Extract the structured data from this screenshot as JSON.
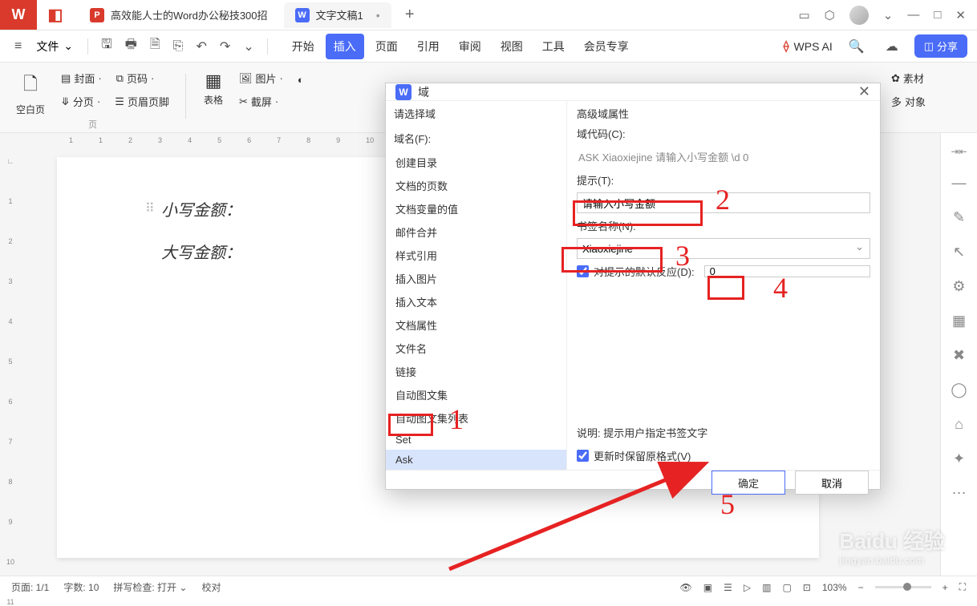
{
  "titlebar": {
    "tab1": "高效能人士的Word办公秘技300招",
    "tab2": "文字文稿1",
    "add": "+"
  },
  "menubar": {
    "file": "文件",
    "tabs": [
      "开始",
      "插入",
      "页面",
      "引用",
      "审阅",
      "视图",
      "工具",
      "会员专享"
    ],
    "active_tab_index": 1,
    "ai": "WPS AI",
    "share": "分享"
  },
  "ribbon": {
    "blank_page": "空白页",
    "cover": "封面",
    "page_break": "分页",
    "page_number": "页码",
    "header_footer": "页眉页脚",
    "group1_label": "页",
    "table": "表格",
    "picture": "图片",
    "screenshot": "截屏",
    "material": "素材",
    "more_objects": "对象"
  },
  "ruler_top": [
    "1",
    "",
    "1",
    "2",
    "3",
    "4",
    "5",
    "6",
    "7",
    "8",
    "9",
    "10"
  ],
  "ruler_left": [
    "1",
    "2",
    "3",
    "4",
    "5",
    "6",
    "7",
    "8",
    "9",
    "10",
    "11"
  ],
  "document": {
    "line1": "小写金额：",
    "line2": "大写金额："
  },
  "dialog": {
    "title": "域",
    "left_header": "请选择域",
    "field_name_label": "域名(F):",
    "items": [
      "创建目录",
      "文档的页数",
      "文档变量的值",
      "邮件合并",
      "样式引用",
      "插入图片",
      "插入文本",
      "文档属性",
      "文件名",
      "链接",
      "自动图文集",
      "自动图文集列表",
      "Set",
      "Ask"
    ],
    "selected_index": 13,
    "right_header": "高级域属性",
    "code_label": "域代码(C):",
    "code_value": "ASK Xiaoxiejine 请输入小写金额 \\d  0",
    "prompt_label": "提示(T):",
    "prompt_value": "请输入小写金额",
    "bookmark_label": "书签名称(N):",
    "bookmark_value": "Xiaoxiejine",
    "default_label": "对提示的默认反应(D):",
    "default_value": "0",
    "description_label": "说明: 提示用户指定书签文字",
    "preserve_label": "更新时保留原格式(V)",
    "ok": "确定",
    "cancel": "取消"
  },
  "statusbar": {
    "page": "页面: 1/1",
    "words": "字数: 10",
    "spell": "拼写检查: 打开",
    "proof": "校对",
    "zoom": "103%"
  },
  "annotations": {
    "n1": "1",
    "n2": "2",
    "n3": "3",
    "n4": "4",
    "n5": "5"
  },
  "watermark": {
    "main": "Baidu 经验",
    "sub": "jingyan.baidu.com"
  }
}
